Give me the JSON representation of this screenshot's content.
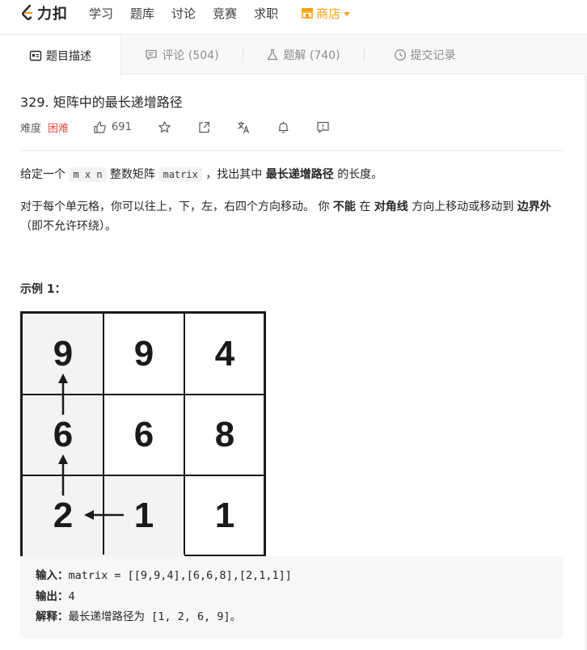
{
  "nav": {
    "logo_text": "力扣",
    "links": [
      "学习",
      "题库",
      "讨论",
      "竞赛",
      "求职"
    ],
    "shop_label": "商店",
    "accent_color": "#ffa116"
  },
  "tabs": [
    {
      "label": "题目描述",
      "icon": "description-icon",
      "active": true
    },
    {
      "label": "评论 (504)",
      "icon": "comment-icon",
      "active": false
    },
    {
      "label": "题解 (740)",
      "icon": "flask-icon",
      "active": false
    },
    {
      "label": "提交记录",
      "icon": "clock-icon",
      "active": false
    }
  ],
  "problem": {
    "title": "329. 矩阵中的最长递增路径",
    "difficulty_label": "难度",
    "difficulty": "困难",
    "difficulty_color": "#ef4743",
    "likes": "691",
    "actions": [
      "like-icon",
      "star-icon",
      "share-icon",
      "translate-icon",
      "bell-icon",
      "feedback-icon"
    ]
  },
  "description": {
    "p1_a": "给定一个 ",
    "p1_code1": "m x n",
    "p1_b": " 整数矩阵 ",
    "p1_code2": "matrix",
    "p1_c": " ，找出其中 ",
    "p1_bold": "最长递增路径",
    "p1_d": " 的长度。",
    "p2_a": "对于每个单元格，你可以往上，下，左，右四个方向移动。 你 ",
    "p2_bold1": "不能",
    "p2_b": " 在 ",
    "p2_bold2": "对角线",
    "p2_c": " 方向上移动或移动到 ",
    "p2_bold3": "边界外",
    "p2_d": "（即不允许环绕）。"
  },
  "example": {
    "title": "示例 1：",
    "matrix": [
      [
        "9",
        "9",
        "4"
      ],
      [
        "6",
        "6",
        "8"
      ],
      [
        "2",
        "1",
        "1"
      ]
    ],
    "input_label": "输入：",
    "input_value": "matrix = [[9,9,4],[6,6,8],[2,1,1]]",
    "output_label": "输出：",
    "output_value": "4",
    "explain_label": "解释：",
    "explain_value": "最长递增路径为 [1, 2, 6, 9]。"
  }
}
